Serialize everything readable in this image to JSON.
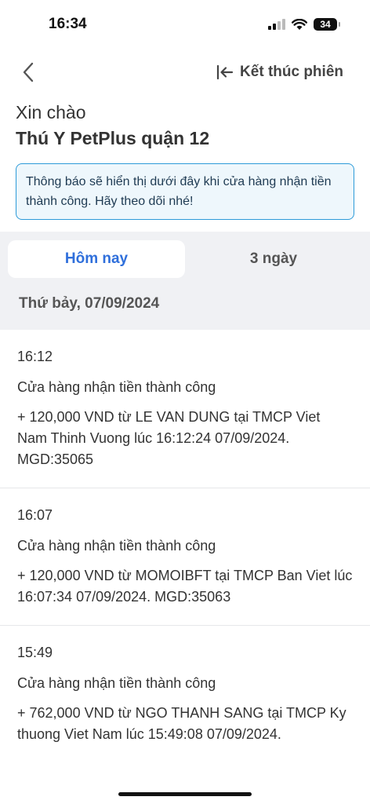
{
  "status_bar": {
    "time": "16:34",
    "battery": "34"
  },
  "nav": {
    "end_session_label": "Kết thúc phiên"
  },
  "greeting": {
    "hello": "Xin chào",
    "store_name": "Thú Y PetPlus quận 12"
  },
  "notice": {
    "text": "Thông báo sẽ hiển thị dưới đây khi cửa hàng nhận tiền thành công. Hãy theo dõi nhé!"
  },
  "tabs": [
    {
      "label": "Hôm nay",
      "active": true
    },
    {
      "label": "3 ngày",
      "active": false
    }
  ],
  "date_header": "Thứ bảy, 07/09/2024",
  "transactions": [
    {
      "time": "16:12",
      "title": "Cửa hàng nhận tiền thành công",
      "detail": "+ 120,000 VND từ LE VAN DUNG tại TMCP Viet Nam Thinh Vuong lúc 16:12:24 07/09/2024. MGD:35065"
    },
    {
      "time": "16:07",
      "title": "Cửa hàng nhận tiền thành công",
      "detail": "+ 120,000 VND từ MOMOIBFT tại TMCP Ban Viet lúc 16:07:34 07/09/2024. MGD:35063"
    },
    {
      "time": "15:49",
      "title": "Cửa hàng nhận tiền thành công",
      "detail": "+ 762,000 VND từ NGO THANH SANG tại TMCP Ky thuong Viet Nam lúc 15:49:08 07/09/2024."
    }
  ],
  "colors": {
    "accent": "#2f6fdb",
    "notice_border": "#2d9bd9",
    "notice_bg": "#eef7fc",
    "gray_bg": "#f0f1f4"
  }
}
